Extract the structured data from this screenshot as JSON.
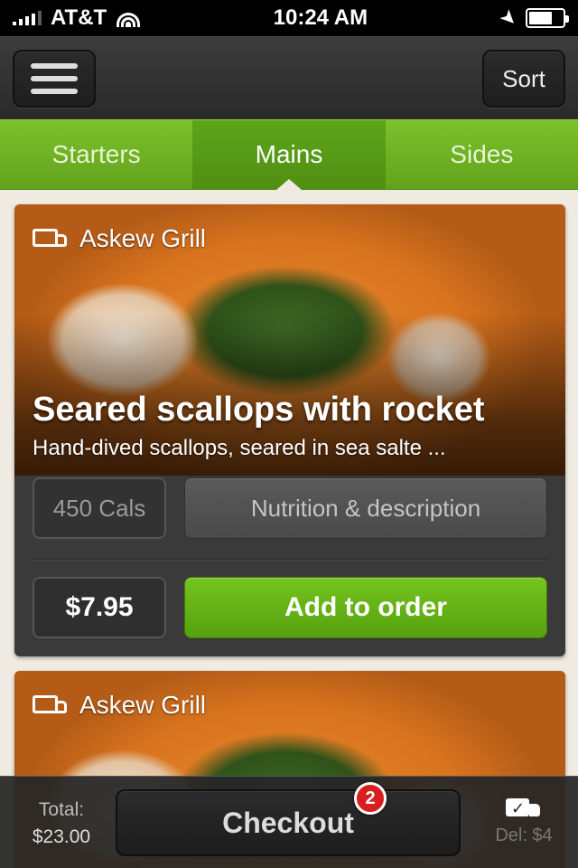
{
  "status_bar": {
    "carrier": "AT&T",
    "time": "10:24 AM"
  },
  "nav": {
    "sort_label": "Sort"
  },
  "tabs": [
    {
      "label": "Starters",
      "active": false
    },
    {
      "label": "Mains",
      "active": true
    },
    {
      "label": "Sides",
      "active": false
    }
  ],
  "items": [
    {
      "restaurant": "Askew Grill",
      "title": "Seared scallops with rocket",
      "description": "Hand-dived scallops, seared in sea salte ...",
      "calories": "450 Cals",
      "nutrition_label": "Nutrition & description",
      "price": "$7.95",
      "add_label": "Add to order"
    },
    {
      "restaurant": "Askew Grill"
    }
  ],
  "footer": {
    "total_label": "Total:",
    "total_amount": "$23.00",
    "checkout_label": "Checkout",
    "cart_count": "2",
    "delivery_label": "Del: $4"
  },
  "colors": {
    "accent_green": "#6ab421",
    "badge_red": "#d81e1e",
    "card_bg": "#3a3a3a"
  },
  "icons": [
    "signal-icon",
    "wifi-icon",
    "location-arrow-icon",
    "battery-icon",
    "menu-icon",
    "truck-icon",
    "delivery-check-icon"
  ]
}
